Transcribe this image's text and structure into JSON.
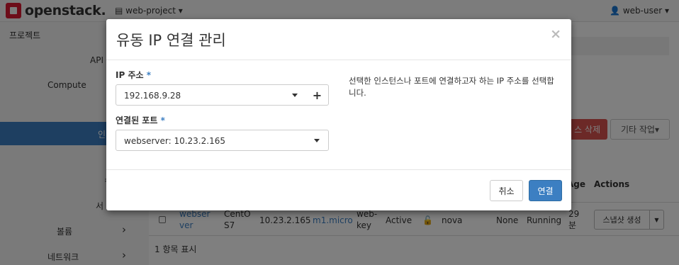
{
  "navbar": {
    "brand": "openstack.",
    "project": "web-project",
    "user": "web-user"
  },
  "sidebar": {
    "items": [
      {
        "label": "프로젝트"
      },
      {
        "label": "API"
      },
      {
        "label": "Compute"
      },
      {
        "label": "인"
      },
      {
        "label": "ㅋ"
      },
      {
        "label": "서"
      },
      {
        "label": "볼륨"
      },
      {
        "label": "네트워크"
      }
    ]
  },
  "page": {
    "delete_label": "스 삭제",
    "more_actions_label": "기타 작업",
    "columns": {
      "age": "Age",
      "actions": "Actions"
    },
    "row": {
      "name": "webserver",
      "image": "CentOS7",
      "ip": "10.23.2.165",
      "flavor": "m1.micro",
      "keypair": "web-key",
      "status": "Active",
      "zone": "nova",
      "task": "None",
      "power": "Running",
      "age": "29 분",
      "action_label": "스냅샷 생성"
    },
    "count_text": "1 항목 표시"
  },
  "modal": {
    "title": "유동 IP 연결 관리",
    "close": "×",
    "ip_label": "IP 주소",
    "ip_value": "192.168.9.28",
    "port_label": "연결된 포트",
    "port_value": "webserver: 10.23.2.165",
    "required_mark": "*",
    "plus": "+",
    "help": "선택한 인스턴스나 포트에 연결하고자 하는 IP 주소를 선택합니다.",
    "cancel_label": "취소",
    "connect_label": "연결"
  },
  "colors": {
    "primary": "#3c7fc2",
    "danger": "#d9534f",
    "brand_red": "#da1a32"
  }
}
